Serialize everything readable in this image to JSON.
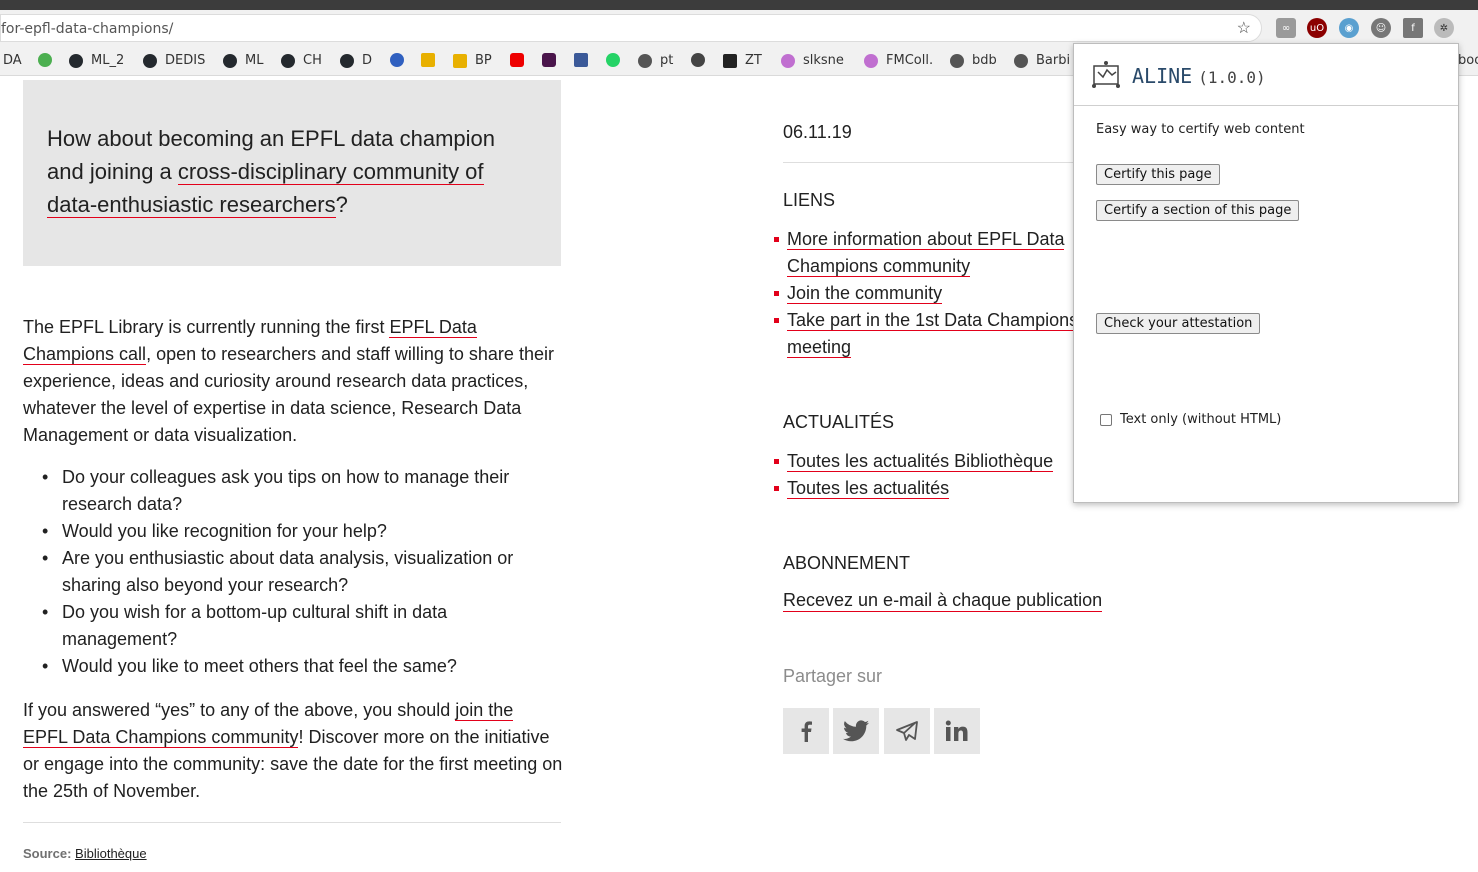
{
  "browser": {
    "url": "for-epfl-data-champions/",
    "bookmarks": [
      "DA",
      "ML_2",
      "DEDIS",
      "ML",
      "CH",
      "D",
      "BP",
      "pt",
      "ZT",
      "slksne",
      "FMColl.",
      "bdb",
      "Barbi",
      "boo"
    ]
  },
  "article": {
    "quote_prefix": "How about becoming an EPFL data champion and joining a ",
    "quote_link": "cross-disciplinary community of data-enthusiastic researchers",
    "quote_suffix": "?",
    "p1_prefix": "The EPFL Library is currently running the first ",
    "p1_link": "EPFL Data Champions call",
    "p1_suffix": ", open to researchers and staff willing to share their experience, ideas and curiosity around research data practices, whatever the level of expertise in data science, Research Data Management or data visualization.",
    "bullets": [
      "Do your colleagues ask you tips on how to manage their research data?",
      "Would you like recognition for your help?",
      "Are you enthusiastic about data analysis, visualization or sharing also beyond your research?",
      "Do you wish for a bottom-up cultural shift in data management?",
      "Would you like to meet others that feel the same?"
    ],
    "p2_prefix": "If you answered “yes” to any of the above, you should ",
    "p2_link": "join the EPFL Data Champions community",
    "p2_suffix": "! Discover more on the initiative or engage into the community: save the date for the first meeting on the 25th of November.",
    "source_label": "Source:",
    "source_link": "Bibliothèque"
  },
  "sidebar": {
    "date": "06.11.19",
    "liens_title": "LIENS",
    "liens": [
      "More information about EPFL Data Champions community",
      "Join the community",
      "Take part in the 1st Data Champions meeting"
    ],
    "actus_title": "ACTUALITÉS",
    "actus": [
      "Toutes les actualités Bibliothèque",
      "Toutes les actualités"
    ],
    "abo_title": "ABONNEMENT",
    "abo_link": "Recevez un e-mail à chaque publication",
    "share_label": "Partager sur"
  },
  "popup": {
    "title": "ALINE",
    "version": "(1.0.0)",
    "description": "Easy way to certify web content",
    "btn_certify_page": "Certify this page",
    "btn_certify_section": "Certify a section of this page",
    "btn_check": "Check your attestation",
    "checkbox_label": "Text only (without HTML)"
  },
  "colors": {
    "accent": "#e2001a",
    "quote_bg": "#e6e6e6"
  }
}
